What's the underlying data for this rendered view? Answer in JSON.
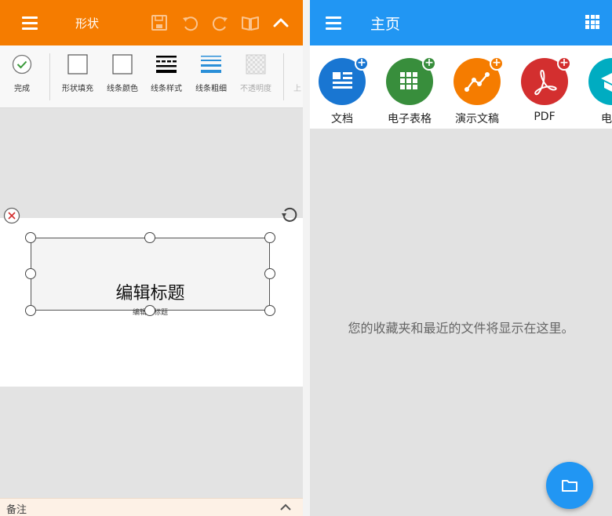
{
  "left_pane": {
    "appbar": {
      "title": "形状",
      "icons": [
        "menu-icon",
        "save-icon",
        "undo-icon",
        "redo-icon",
        "read-mode-icon",
        "collapse-chevron-icon"
      ],
      "color": "#f57c00"
    },
    "ribbon": {
      "tools": [
        {
          "label": "完成",
          "icon": "checkmark-icon"
        },
        {
          "label": "形状填充",
          "icon": "shape-fill-icon"
        },
        {
          "label": "线条颜色",
          "icon": "line-color-icon"
        },
        {
          "label": "线条样式",
          "icon": "line-style-icon"
        },
        {
          "label": "线条粗细",
          "icon": "line-weight-icon"
        },
        {
          "label": "不透明度",
          "icon": "opacity-icon",
          "disabled": true
        },
        {
          "label": "上",
          "icon": "move-up-icon",
          "partial": true
        }
      ]
    },
    "shape": {
      "title": "编辑标题",
      "subtitle": "编辑副标题"
    },
    "notes_label": "备注"
  },
  "right_pane": {
    "appbar": {
      "title": "主页",
      "icons": [
        "menu-icon",
        "grid-view-icon"
      ],
      "color": "#2196f3"
    },
    "tiles": [
      {
        "label": "文档",
        "color": "#1976d2",
        "badge": "#1976d2",
        "icon": "document-icon"
      },
      {
        "label": "电子表格",
        "color": "#388e3c",
        "badge": "#388e3c",
        "icon": "spreadsheet-icon"
      },
      {
        "label": "演示文稿",
        "color": "#f57c00",
        "badge": "#f57c00",
        "icon": "presentation-icon"
      },
      {
        "label": "PDF",
        "color": "#d32f2f",
        "badge": "#d32f2f",
        "icon": "pdf-icon"
      },
      {
        "label": "电子",
        "color": "#00acc1",
        "badge": "#00acc1",
        "icon": "ebook-icon"
      }
    ],
    "empty_message": "您的收藏夹和最近的文件将显示在这里。",
    "fab_icon": "folder-icon"
  }
}
